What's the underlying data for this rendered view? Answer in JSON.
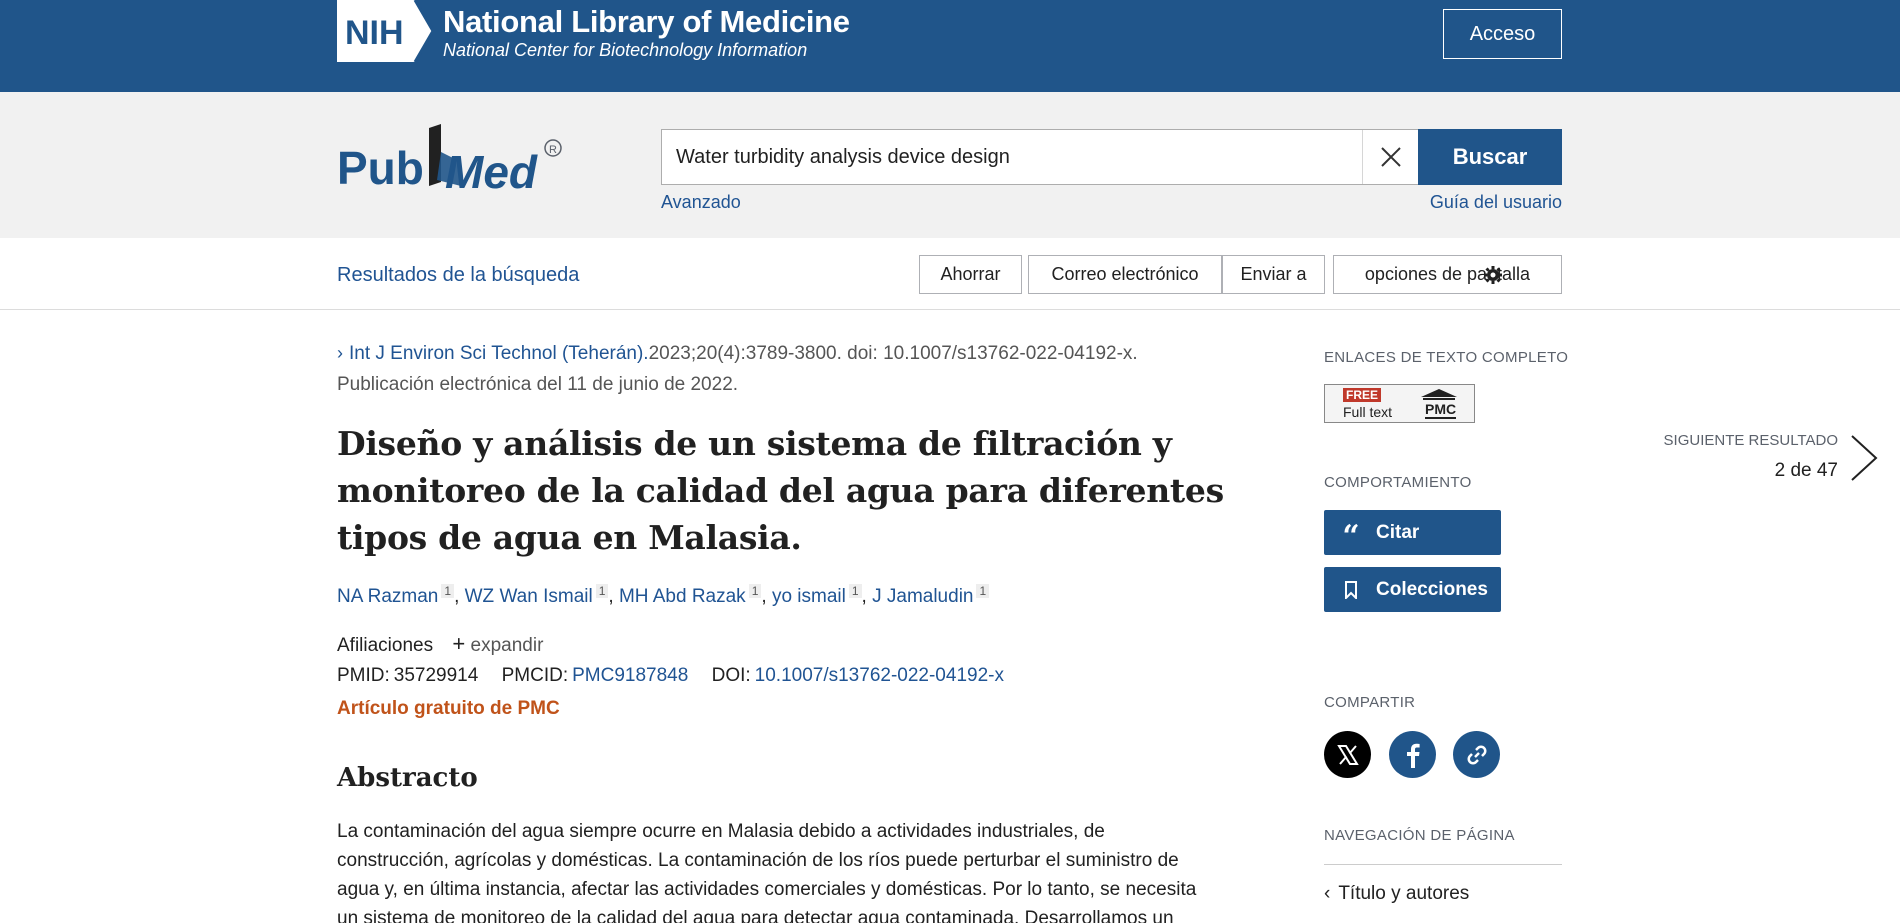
{
  "nih": {
    "title": "National Library of Medicine",
    "subtitle": "National Center for Biotechnology Information",
    "logo_text": "NIH",
    "login_label": "Acceso"
  },
  "search": {
    "query": "Water turbidity analysis device design",
    "button_label": "Buscar",
    "advanced_label": "Avanzado",
    "guide_label": "Guía del usuario"
  },
  "actions": {
    "results_link": "Resultados de la búsqueda",
    "save_label": "Ahorrar",
    "email_label": "Correo electrónico",
    "send_label": "Enviar a",
    "display_label": "opciones de pantalla"
  },
  "article": {
    "journal": "Int J Environ Sci Technol (Teherán).",
    "citation": "2023;20(4):3789-3800. doi: 10.1007/s13762-022-04192-x.",
    "epub": "Publicación electrónica del 11 de junio de 2022.",
    "title": "Diseño y análisis de un sistema de filtración y monitoreo de la calidad del agua para diferentes tipos de agua en Malasia.",
    "authors": [
      {
        "name": "NA Razman",
        "sup": "1"
      },
      {
        "name": "WZ Wan Ismail",
        "sup": "1"
      },
      {
        "name": "MH Abd Razak",
        "sup": "1"
      },
      {
        "name": "yo ismail",
        "sup": "1"
      },
      {
        "name": "J Jamaludin",
        "sup": "1"
      }
    ],
    "affiliations_label": "Afiliaciones",
    "expand_label": "expandir",
    "pmid_label": "PMID:",
    "pmid": "35729914",
    "pmcid_label": "PMCID:",
    "pmcid": "PMC9187848",
    "doi_label": "DOI:",
    "doi": "10.1007/s13762-022-04192-x",
    "free_label": "Artículo gratuito de PMC",
    "abstract_heading": "Abstracto",
    "abstract_lines": [
      "La contaminación del agua siempre ocurre en Malasia debido a actividades industriales, de",
      "construcción, agrícolas y domésticas. La contaminación de los ríos puede perturbar el suministro de",
      "agua y, en última instancia, afectar las actividades comerciales y domésticas. Por lo tanto, se necesita",
      "un sistema de monitoreo de la calidad del agua para detectar agua contaminada. Desarrollamos un"
    ]
  },
  "sidebar": {
    "fulltext_heading": "ENLACES DE TEXTO COMPLETO",
    "badge_free": "FREE",
    "badge_fulltext": "Full text",
    "badge_pmc": "PMC",
    "behavior_heading": "COMPORTAMIENTO",
    "cite_label": "Citar",
    "collections_label": "Colecciones",
    "share_heading": "COMPARTIR",
    "nav_heading": "NAVEGACIÓN DE PÁGINA",
    "nav_item": "Título y autores"
  },
  "next_result": {
    "label": "SIGUIENTE RESULTADO",
    "count": "2 de 47"
  },
  "colors": {
    "brand_blue": "#20558a",
    "link_blue": "#205493",
    "free_orange": "#c0531a"
  }
}
